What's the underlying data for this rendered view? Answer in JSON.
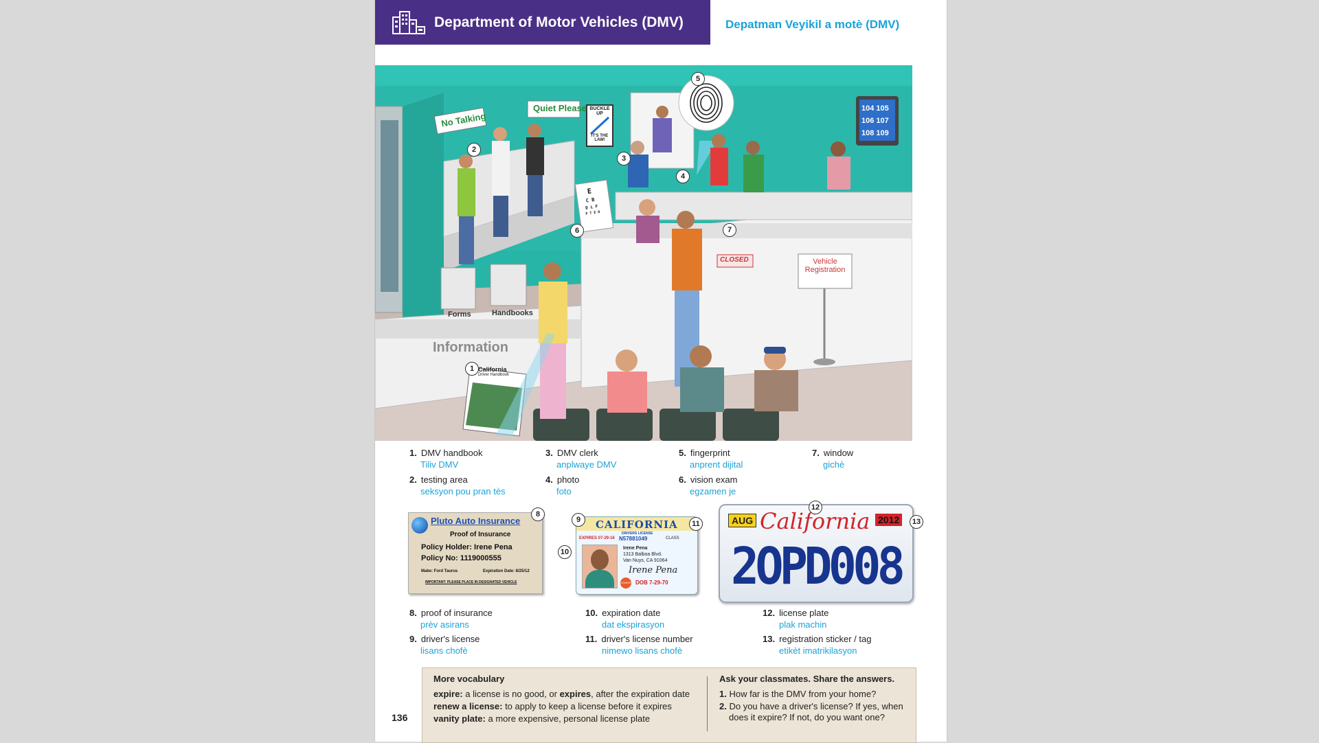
{
  "header": {
    "title": "Department of Motor Vehicles (DMV)",
    "translation": "Depatman Veyikil a motè (DMV)"
  },
  "scene_signs": {
    "no_talking": "No Talking",
    "quiet_please": "Quiet Please",
    "buckle_up": "BUCKLE UP",
    "its_the_law": "IT'S THE LAW!",
    "closed": "CLOSED",
    "vehicle_registration_1": "Vehicle",
    "vehicle_registration_2": "Registration",
    "forms": "Forms",
    "handbooks": "Handbooks",
    "information": "Information",
    "handbook_cover_1": "California",
    "handbook_cover_2": "Driver Handbook",
    "screen_numbers": [
      "104",
      "105",
      "106",
      "107",
      "108",
      "109"
    ]
  },
  "vocabulary_top": [
    {
      "num": "1.",
      "en": "DMV handbook",
      "tr": "Tiliv DMV"
    },
    {
      "num": "2.",
      "en": "testing area",
      "tr": "seksyon pou pran tès"
    },
    {
      "num": "3.",
      "en": "DMV clerk",
      "tr": "anplwaye DMV"
    },
    {
      "num": "4.",
      "en": "photo",
      "tr": "foto"
    },
    {
      "num": "5.",
      "en": "fingerprint",
      "tr": "anprent dijital"
    },
    {
      "num": "6.",
      "en": "vision exam",
      "tr": "egzamen je"
    },
    {
      "num": "7.",
      "en": "window",
      "tr": "gichè"
    }
  ],
  "vocabulary_bottom": [
    {
      "num": "8.",
      "en": "proof of insurance",
      "tr": "prèv asirans"
    },
    {
      "num": "9.",
      "en": "driver's license",
      "tr": "lisans chofè"
    },
    {
      "num": "10.",
      "en": "expiration date",
      "tr": "dat ekspirasyon"
    },
    {
      "num": "11.",
      "en": "driver's license number",
      "tr": "nimewo lisans chofè"
    },
    {
      "num": "12.",
      "en": "license plate",
      "tr": "plak machin"
    },
    {
      "num": "13.",
      "en": "registration sticker / tag",
      "tr": "etikèt imatrikilasyon"
    }
  ],
  "callouts": [
    "1",
    "2",
    "3",
    "4",
    "5",
    "6",
    "7",
    "8",
    "9",
    "10",
    "11",
    "12",
    "13"
  ],
  "insurance_card": {
    "company": "Pluto Auto Insurance",
    "title": "Proof of Insurance",
    "holder": "Policy Holder: Irene Pena",
    "policy_no": "Policy No: 1119000555",
    "make": "Make: Ford Taurus",
    "expiration": "Expiration Date: 8/25/12",
    "notice": "IMPORTANT: PLEASE PLACE IN DESIGNATED VEHICLE"
  },
  "license_card": {
    "state": "CALIFORNIA",
    "subtitle": "DRIVERS LICENSE",
    "expires": "EXPIRES 07-29-16",
    "number": "N57881049",
    "class": "CLASS",
    "name": "Irene Pena",
    "addr1": "1313 Balboa Blvd.",
    "addr2": "Van Nuys, CA 91064",
    "signature": "Irene Pena",
    "donor": "DONOR",
    "dob": "DOB 7-29-70"
  },
  "plate": {
    "month": "AUG",
    "state": "California",
    "year": "2012",
    "number": "2OPD008"
  },
  "more_vocab": {
    "title": "More vocabulary",
    "lines": [
      {
        "term": "expire:",
        "def": " a license is no good, or ",
        "term2": "expires",
        "def2": ", after the expiration date"
      },
      {
        "term": "renew a license:",
        "def": " to apply to keep a license before it expires"
      },
      {
        "term": "vanity plate:",
        "def": " a more expensive, personal license plate"
      }
    ]
  },
  "ask": {
    "title": "Ask your classmates. Share the answers.",
    "q1_num": "1.",
    "q1": "How far is the DMV from your home?",
    "q2_num": "2.",
    "q2a": "Do you have a driver's license? If yes, when",
    "q2b": "does it expire? If not, do you want one?"
  },
  "page_number": "136",
  "colors": {
    "header_bg": "#4a2f86",
    "translation": "#1aa3d9",
    "wall": "#27b5a7",
    "plate_blue": "#17348f",
    "plate_red": "#d2232a"
  }
}
